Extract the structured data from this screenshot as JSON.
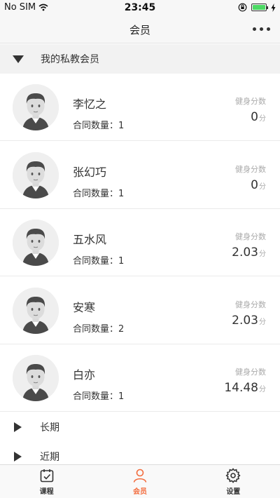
{
  "status_bar": {
    "carrier": "No SIM",
    "time": "23:45"
  },
  "nav": {
    "title": "会员"
  },
  "sections": {
    "private": {
      "label": "我的私教会员"
    },
    "long_term": {
      "label": "长期"
    },
    "recent": {
      "label": "近期"
    }
  },
  "score_label": "健身分数",
  "score_unit": "分",
  "members": [
    {
      "name": "李忆之",
      "contracts": "合同数量：1",
      "score": "0"
    },
    {
      "name": "张幻巧",
      "contracts": "合同数量：1",
      "score": "0"
    },
    {
      "name": "五水风",
      "contracts": "合同数量：1",
      "score": "2.03"
    },
    {
      "name": "安寒",
      "contracts": "合同数量：2",
      "score": "2.03"
    },
    {
      "name": "白亦",
      "contracts": "合同数量：1",
      "score": "14.48"
    }
  ],
  "tabs": [
    {
      "label": "课程",
      "icon": "calendar-check-icon"
    },
    {
      "label": "会员",
      "icon": "user-icon"
    },
    {
      "label": "设置",
      "icon": "gear-icon"
    }
  ],
  "colors": {
    "accent": "#f36c3d",
    "battery": "#4cd964"
  }
}
